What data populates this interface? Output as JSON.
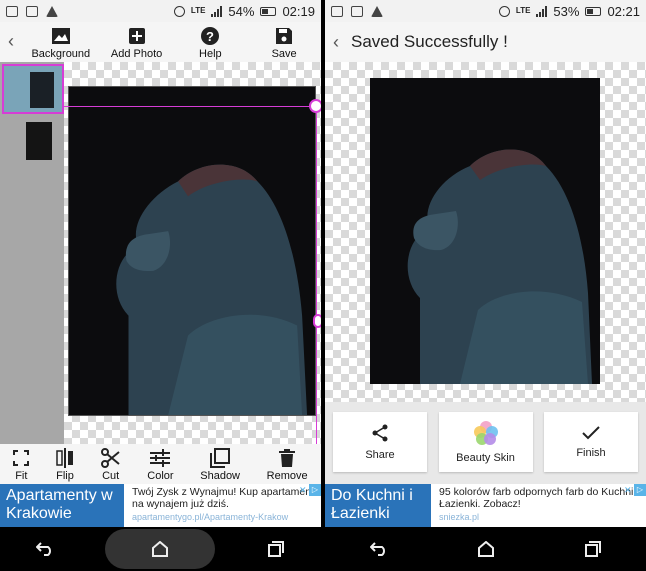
{
  "left": {
    "status": {
      "network": "LTE",
      "battery": "54%",
      "time": "02:19"
    },
    "toolbar_top": [
      {
        "label": "Background",
        "icon": "background-image-icon"
      },
      {
        "label": "Add Photo",
        "icon": "add-photo-icon"
      },
      {
        "label": "Help",
        "icon": "help-icon"
      },
      {
        "label": "Save",
        "icon": "save-icon"
      }
    ],
    "toolbar_bottom": [
      {
        "label": "Fit",
        "icon": "fit-icon"
      },
      {
        "label": "Flip",
        "icon": "flip-icon"
      },
      {
        "label": "Cut",
        "icon": "scissors-icon"
      },
      {
        "label": "Color",
        "icon": "sliders-icon"
      },
      {
        "label": "Shadow",
        "icon": "shadow-icon"
      },
      {
        "label": "Remove",
        "icon": "trash-icon"
      }
    ],
    "ad": {
      "headline": "Apartamenty w Krakowie",
      "text": "Twój Zysk z Wynajmu! Kup apartament na wynajem już dziś.",
      "url": "apartamentygo.pl/Apartamenty-Krakow"
    }
  },
  "right": {
    "status": {
      "network": "LTE",
      "battery": "53%",
      "time": "02:21"
    },
    "title": "Saved Successfully !",
    "actions": [
      {
        "label": "Share",
        "icon": "share-icon"
      },
      {
        "label": "Beauty Skin",
        "icon": "beauty-skin-icon"
      },
      {
        "label": "Finish",
        "icon": "checkmark-icon"
      }
    ],
    "ad": {
      "headline": "Do Kuchni i Łazienki",
      "text": "95 kolorów farb odpornych farb do Kuchni i Łazienki. Zobacz!",
      "url": "sniezka.pl"
    }
  },
  "colors": {
    "accent": "#d63dd6",
    "ad_blue": "#2a73b9",
    "photo_bg": "#0c0c0e"
  }
}
